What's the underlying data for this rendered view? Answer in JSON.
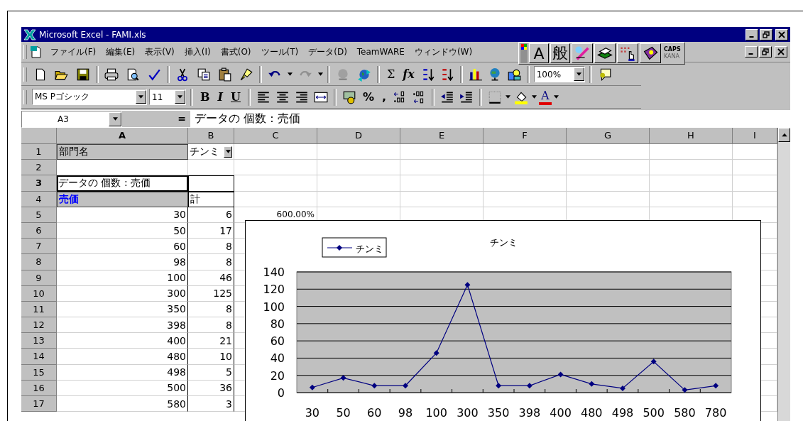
{
  "window": {
    "title": "Microsoft Excel - FAMI.xls"
  },
  "menu": [
    "ファイル(F)",
    "編集(E)",
    "表示(V)",
    "挿入(I)",
    "書式(O)",
    "ツール(T)",
    "データ(D)",
    "TeamWARE",
    "ウィンドウ(W)"
  ],
  "ime_bar": {
    "modes": [
      "A",
      "般"
    ],
    "caps": "CAPS",
    "kana": {
      "text": "KANA",
      "on": false
    }
  },
  "standard_toolbar": {
    "glyphs": [
      "Σ",
      "fx"
    ],
    "zoom": "100%"
  },
  "formatting_toolbar": {
    "font": "MS Pゴシック",
    "size": "11",
    "style_glyphs": [
      "B",
      "I",
      "U"
    ],
    "number_glyphs": [
      "%",
      ","
    ],
    "font_color_glyph": "A"
  },
  "formula_bar": {
    "cell": "A3",
    "equals": "=",
    "value": "データの 個数 : 売価"
  },
  "columns": [
    "A",
    "B",
    "C",
    "D",
    "E",
    "F",
    "G",
    "H",
    "I"
  ],
  "rows": [
    {
      "num": "1",
      "kind": "page_field",
      "a": "部門名",
      "b": "チンミ",
      "selected": false
    },
    {
      "num": "2",
      "kind": "blank",
      "selected": false
    },
    {
      "num": "3",
      "kind": "data_field",
      "a": "データの 個数 : 売価",
      "selected": true
    },
    {
      "num": "4",
      "kind": "row_field",
      "a": "売価",
      "b": "計",
      "selected": false
    },
    {
      "num": "5",
      "kind": "number",
      "a": "30",
      "b": "6",
      "c": "600.00%",
      "selected": false
    },
    {
      "num": "6",
      "kind": "number",
      "a": "50",
      "b": "17",
      "selected": false
    },
    {
      "num": "7",
      "kind": "number",
      "a": "60",
      "b": "8",
      "selected": false
    },
    {
      "num": "8",
      "kind": "number",
      "a": "98",
      "b": "8",
      "selected": false
    },
    {
      "num": "9",
      "kind": "number",
      "a": "100",
      "b": "46",
      "selected": false
    },
    {
      "num": "10",
      "kind": "number",
      "a": "300",
      "b": "125",
      "selected": false
    },
    {
      "num": "11",
      "kind": "number",
      "a": "350",
      "b": "8",
      "selected": false
    },
    {
      "num": "12",
      "kind": "number",
      "a": "398",
      "b": "8",
      "selected": false
    },
    {
      "num": "13",
      "kind": "number",
      "a": "400",
      "b": "21",
      "selected": false
    },
    {
      "num": "14",
      "kind": "number",
      "a": "480",
      "b": "10",
      "selected": false
    },
    {
      "num": "15",
      "kind": "number",
      "a": "498",
      "b": "5",
      "selected": false
    },
    {
      "num": "16",
      "kind": "number",
      "a": "500",
      "b": "36",
      "selected": false
    },
    {
      "num": "17",
      "kind": "number",
      "a": "580",
      "b": "3",
      "selected": false
    }
  ],
  "chart": {
    "chart_data": {
      "type": "line",
      "title": "チンミ",
      "categories": [
        "30",
        "50",
        "60",
        "98",
        "100",
        "300",
        "350",
        "398",
        "400",
        "480",
        "498",
        "500",
        "580",
        "780"
      ],
      "series": [
        {
          "name": "チンミ",
          "color": "#000080",
          "marker": "diamond",
          "values": [
            6,
            17,
            8,
            8,
            46,
            125,
            8,
            8,
            21,
            10,
            5,
            36,
            3,
            8
          ]
        }
      ],
      "grid": true,
      "ylim": [
        0,
        140
      ],
      "yticks": [
        0,
        20,
        40,
        60,
        80,
        100,
        120,
        140
      ]
    }
  }
}
